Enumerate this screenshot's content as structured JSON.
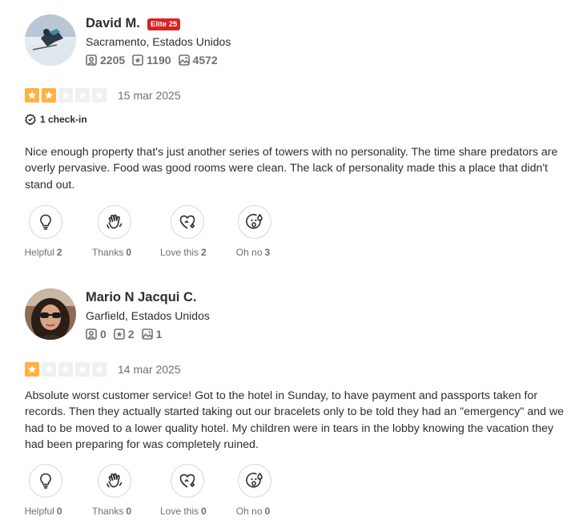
{
  "reviews": [
    {
      "user": {
        "name": "David M.",
        "badge": "Elite 25",
        "location": "Sacramento, Estados Unidos",
        "friends": "2205",
        "reviews": "1190",
        "photos": "4572"
      },
      "rating": 2,
      "max_rating": 5,
      "date": "15 mar 2025",
      "checkin": "1 check-in",
      "text": "Nice enough property that's just another series of towers with no personality. The time share predators are overly pervasive. Food was good rooms were clean. The lack of personality made this a place that didn't stand out.",
      "reactions": [
        {
          "label": "Helpful",
          "count": "2"
        },
        {
          "label": "Thanks",
          "count": "0"
        },
        {
          "label": "Love this",
          "count": "2"
        },
        {
          "label": "Oh no",
          "count": "3"
        }
      ]
    },
    {
      "user": {
        "name": "Mario N Jacqui C.",
        "location": "Garfield, Estados Unidos",
        "friends": "0",
        "reviews": "2",
        "photos": "1"
      },
      "rating": 1,
      "max_rating": 5,
      "date": "14 mar 2025",
      "text": "Absolute worst customer service! Got to the hotel in Sunday, to have payment and passports taken for records. Then they actually started taking out our bracelets only to be told they had an \"emergency\" and we had to be moved to a lower quality hotel. My children were in tears in the lobby knowing the vacation they had been preparing for was completely ruined.",
      "reactions": [
        {
          "label": "Helpful",
          "count": "0"
        },
        {
          "label": "Thanks",
          "count": "0"
        },
        {
          "label": "Love this",
          "count": "0"
        },
        {
          "label": "Oh no",
          "count": "0"
        }
      ]
    }
  ],
  "colors": {
    "star_on": "#ffb241",
    "star_off": "#f0f0f0",
    "elite_badge": "#d32323"
  }
}
